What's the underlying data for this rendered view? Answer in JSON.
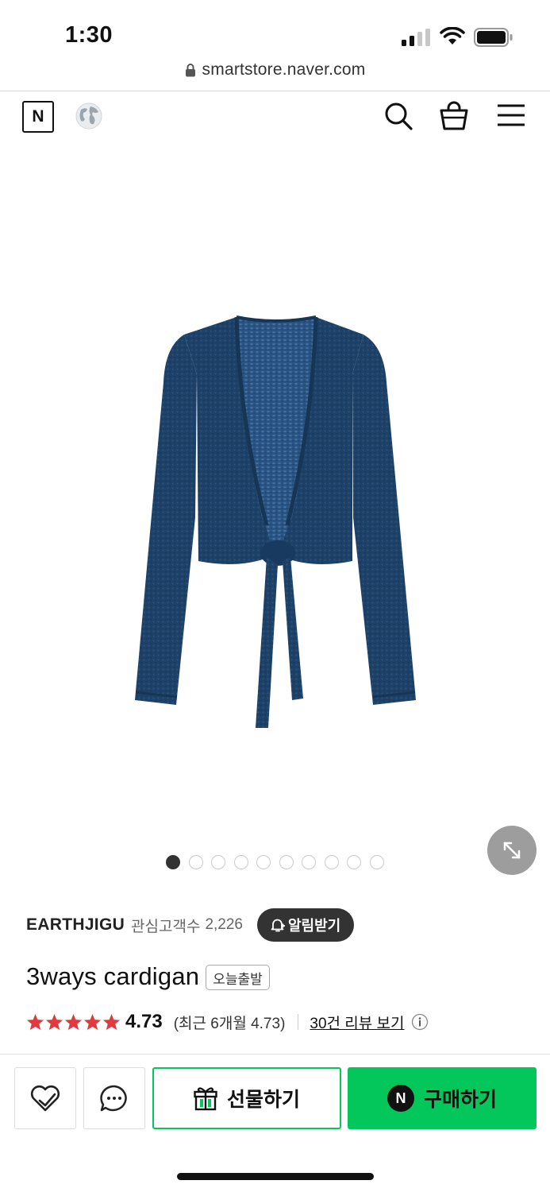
{
  "status_bar": {
    "time": "1:30"
  },
  "browser": {
    "url": "smartstore.naver.com"
  },
  "nav": {
    "logo_letter": "N",
    "icons": [
      "globe-icon",
      "search-icon",
      "shopping-bag-icon",
      "menu-icon"
    ]
  },
  "gallery": {
    "image_count": 10,
    "active_index": 0,
    "product_color": "#1d3f66"
  },
  "store": {
    "name": "EARTHJIGU",
    "interest_label": "관심고객수",
    "interest_count": "2,226",
    "alarm_label": "알림받기"
  },
  "product": {
    "title": "3ways cardigan",
    "badge": "오늘출발",
    "rating": "4.73",
    "stars": 5,
    "recent_rating": "(최근 6개월 4.73)",
    "review_link": "30건 리뷰 보기"
  },
  "actions": {
    "gift_label": "선물하기",
    "buy_label": "구매하기",
    "buy_logo": "N"
  },
  "colors": {
    "naver_green": "#03c75a",
    "star_red": "#e0393e",
    "dark_pill": "#333333"
  }
}
